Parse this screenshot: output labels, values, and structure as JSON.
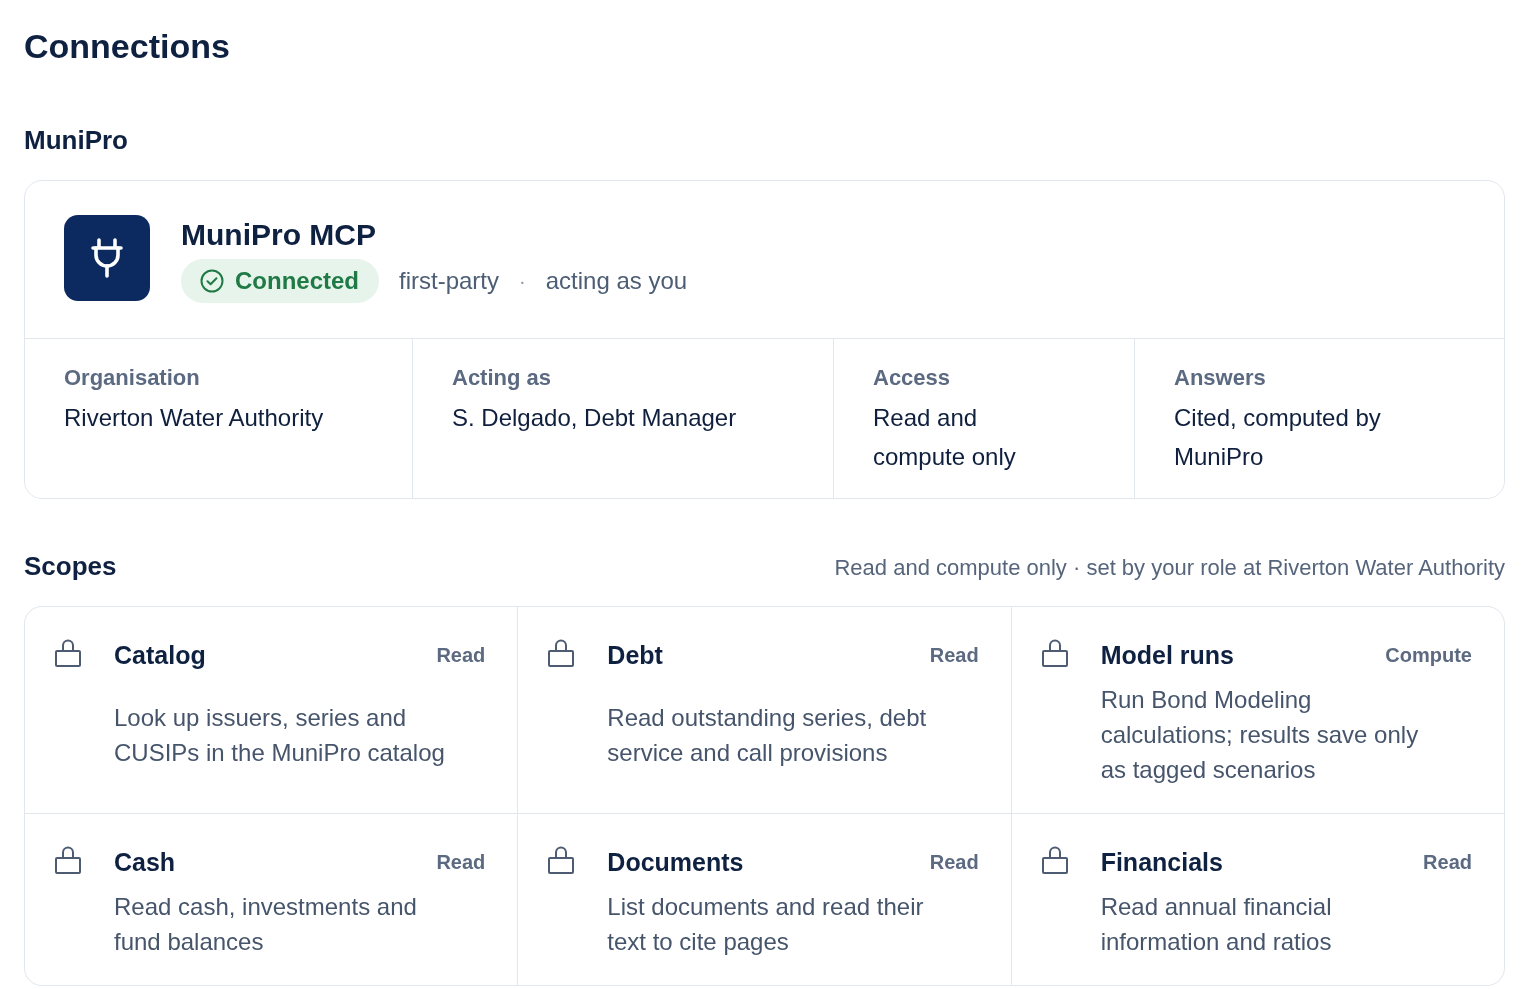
{
  "page": {
    "title": "Connections"
  },
  "connection": {
    "section_title": "MuniPro",
    "name": "MuniPro MCP",
    "status": {
      "label": "Connected",
      "kind": "connected"
    },
    "origin": "first-party",
    "separator": "·",
    "mode": "acting as you",
    "details": [
      {
        "label": "Organisation",
        "value": "Riverton Water Authority"
      },
      {
        "label": "Acting as",
        "value": "S. Delgado, Debt Manager"
      },
      {
        "label": "Access",
        "value": "Read and compute only"
      },
      {
        "label": "Answers",
        "value": "Cited, computed by MuniPro"
      }
    ]
  },
  "scopes": {
    "title": "Scopes",
    "note": "Read and compute only · set by your role at Riverton Water Authority",
    "items": [
      {
        "name": "Catalog",
        "access": "Read",
        "description": "Look up issuers, series and CUSIPs in the MuniPro catalog"
      },
      {
        "name": "Debt",
        "access": "Read",
        "description": "Read outstanding series, debt service and call provisions"
      },
      {
        "name": "Model runs",
        "access": "Compute",
        "description": "Run Bond Modeling calculations; results save only as tagged scenarios"
      },
      {
        "name": "Cash",
        "access": "Read",
        "description": "Read cash, investments and fund balances"
      },
      {
        "name": "Documents",
        "access": "Read",
        "description": "List documents and read their text to cite pages"
      },
      {
        "name": "Financials",
        "access": "Read",
        "description": "Read annual financial information and ratios"
      }
    ]
  }
}
